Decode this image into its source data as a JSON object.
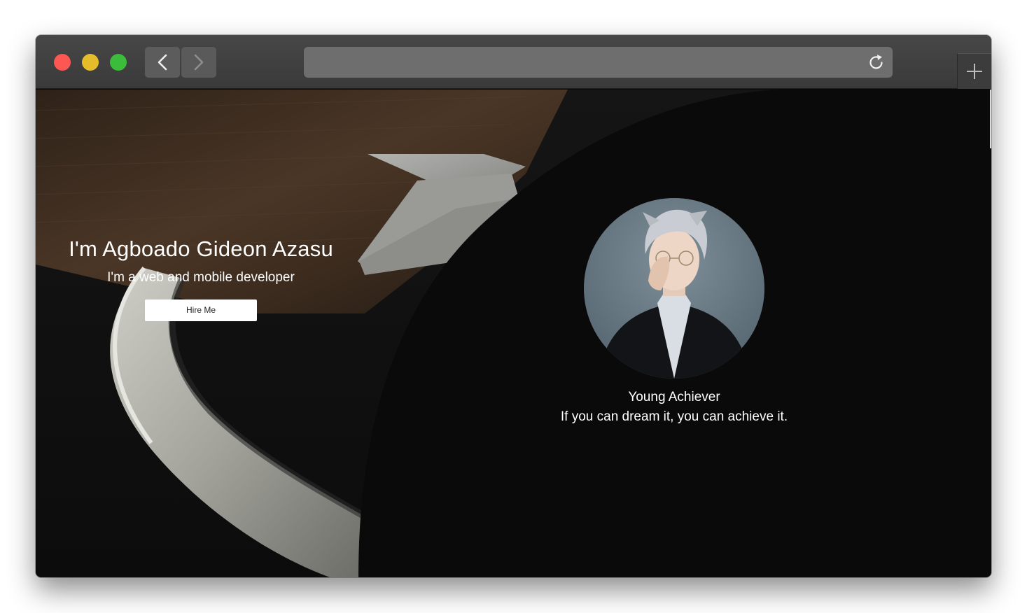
{
  "browser": {
    "url": "",
    "colors": {
      "close": "#fc5753",
      "minimize": "#e5bd2a",
      "maximize": "#3bbc3b"
    }
  },
  "hero": {
    "title": "I'm Agboado Gideon Azasu",
    "subtitle": "I'm a web and mobile developer",
    "cta_label": "Hire Me"
  },
  "profile": {
    "name": "Young Achiever",
    "quote": "If you can dream it, you can achieve it."
  }
}
